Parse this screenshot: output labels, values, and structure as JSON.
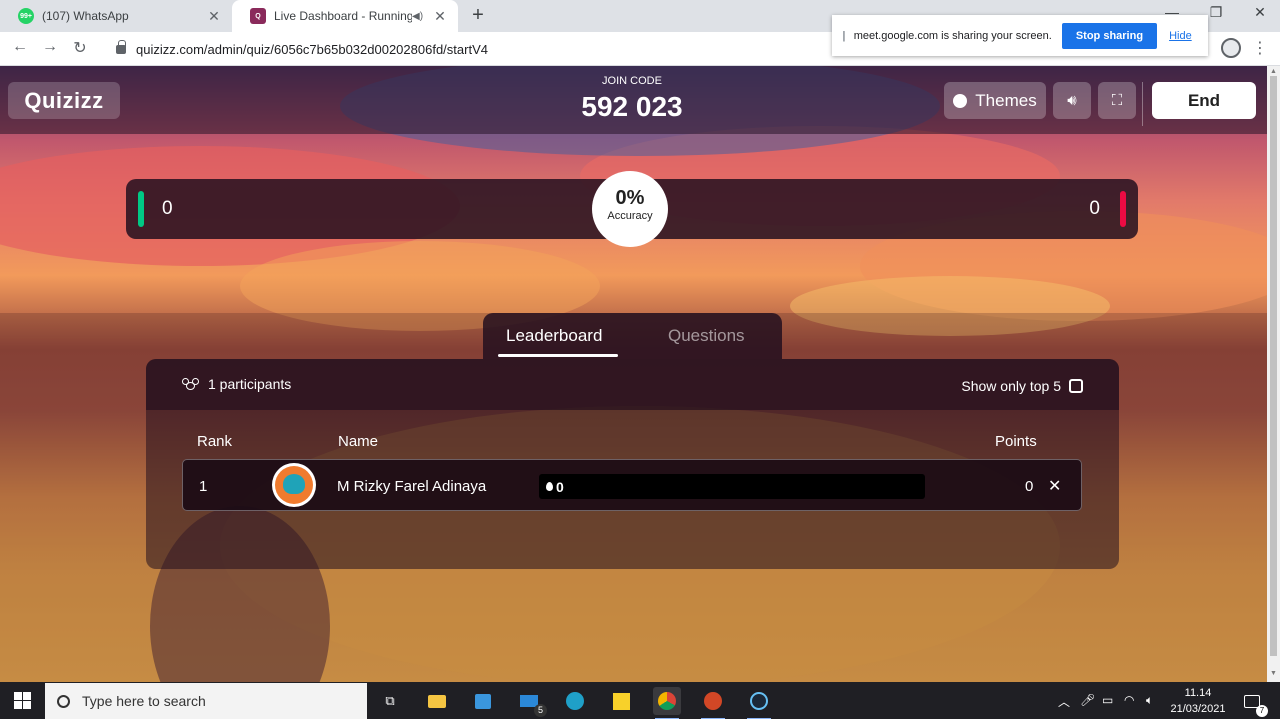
{
  "browser": {
    "tabs": [
      {
        "title": "(107) WhatsApp",
        "badge": "99+",
        "active": false
      },
      {
        "title": "Live Dashboard - Running",
        "active": true
      }
    ],
    "url": "quizizz.com/admin/quiz/6056c7b65b032d00202806fd/startV4"
  },
  "share_bar": {
    "message": "meet.google.com is sharing your screen.",
    "stop_label": "Stop sharing",
    "hide_label": "Hide"
  },
  "header": {
    "logo": "Quizizz",
    "join_code_label": "JOIN CODE",
    "join_code": "592 023",
    "themes_label": "Themes",
    "end_label": "End"
  },
  "accuracy": {
    "correct": "0",
    "incorrect": "0",
    "percent": "0%",
    "label": "Accuracy"
  },
  "tabs": [
    {
      "label": "Leaderboard",
      "active": true
    },
    {
      "label": "Questions",
      "active": false
    }
  ],
  "leaderboard": {
    "participants_label": "1 participants",
    "top5_label": "Show only top 5",
    "columns": {
      "rank": "Rank",
      "name": "Name",
      "points": "Points"
    },
    "rows": [
      {
        "rank": "1",
        "name": "M Rizky Farel Adinaya",
        "streak": "0",
        "points": "0"
      }
    ]
  },
  "taskbar": {
    "search_placeholder": "Type here to search",
    "mail_badge": "5",
    "time": "11.14",
    "date": "21/03/2021",
    "notification_count": "7"
  },
  "colors": {
    "correct": "#00c985",
    "incorrect": "#ec0b43",
    "share_button": "#1a73e8"
  }
}
